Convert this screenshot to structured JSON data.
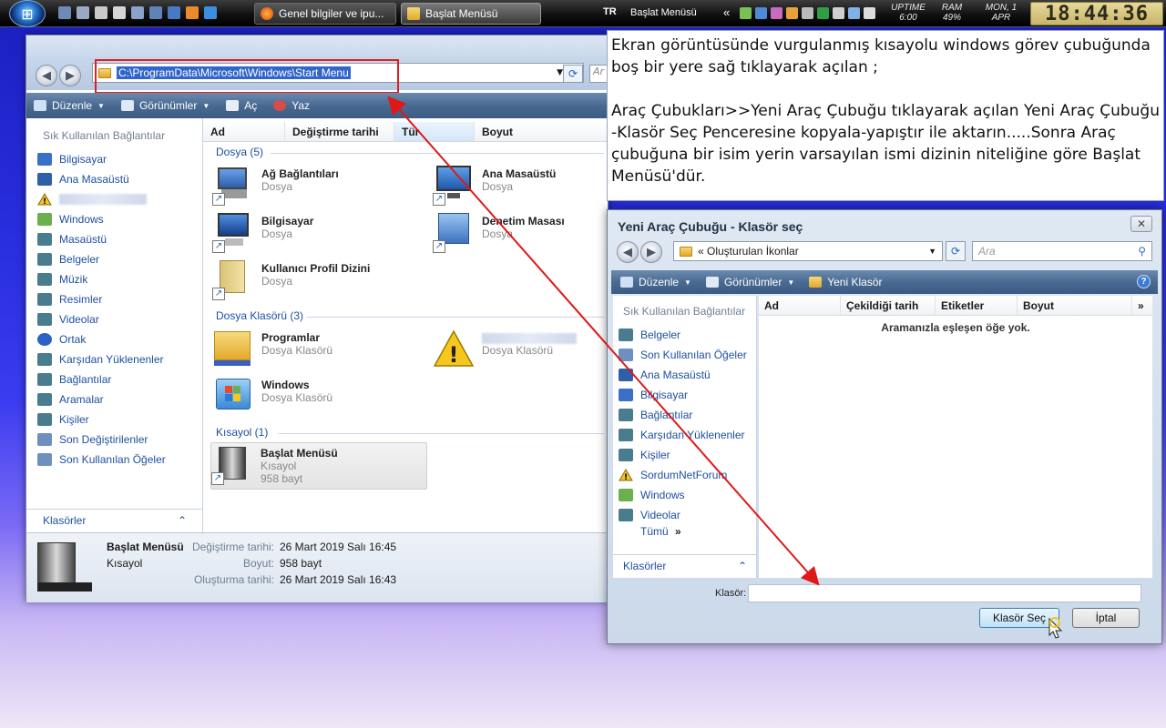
{
  "taskbar": {
    "start_icon": "windows-orb-icon",
    "task1_label": "Genel bilgiler ve ipu...",
    "task2_label": "Başlat Menüsü",
    "lang": "TR",
    "toolbar_name": "Başlat Menüsü",
    "uptime_label": "UPTIME",
    "uptime_value": "6:00",
    "ram_label": "RAM",
    "ram_value": "49%",
    "date_day": "MON, 1",
    "date_month": "APR",
    "clock": "18:44:36"
  },
  "explorer": {
    "address": "C:\\ProgramData\\Microsoft\\Windows\\Start Menu",
    "search_stub": "Ar",
    "toolbar": {
      "organize": "Düzenle",
      "views": "Görünümler",
      "open": "Aç",
      "print": "Yaz"
    },
    "nav_header": "Sık Kullanılan Bağlantılar",
    "nav_items": [
      {
        "label": "Bilgisayar",
        "icon": "computer-icon",
        "color": "#3a6fc8"
      },
      {
        "label": "Ana Masaüstü",
        "icon": "desktop-icon",
        "color": "#2f5fa8"
      },
      {
        "label": "",
        "icon": "warning-icon",
        "color": "#f2c230"
      },
      {
        "label": "Windows",
        "icon": "windows-folder-icon",
        "color": "#6ab04c"
      },
      {
        "label": "Masaüstü",
        "icon": "desktop-folder-icon",
        "color": "#4a7c8f"
      },
      {
        "label": "Belgeler",
        "icon": "documents-icon",
        "color": "#4a7c8f"
      },
      {
        "label": "Müzik",
        "icon": "music-icon",
        "color": "#4a7c8f"
      },
      {
        "label": "Resimler",
        "icon": "pictures-icon",
        "color": "#4a7c8f"
      },
      {
        "label": "Videolar",
        "icon": "videos-icon",
        "color": "#4a7c8f"
      },
      {
        "label": "Ortak",
        "icon": "info-icon",
        "color": "#2a62c6"
      },
      {
        "label": "Karşıdan Yüklenenler",
        "icon": "downloads-icon",
        "color": "#4a7c8f"
      },
      {
        "label": "Bağlantılar",
        "icon": "links-icon",
        "color": "#4a7c8f"
      },
      {
        "label": "Aramalar",
        "icon": "searches-icon",
        "color": "#4a7c8f"
      },
      {
        "label": "Kişiler",
        "icon": "contacts-icon",
        "color": "#4a7c8f"
      },
      {
        "label": "Son Değiştirilenler",
        "icon": "recent-changes-icon",
        "color": "#6e8fbf"
      },
      {
        "label": "Son Kullanılan Öğeler",
        "icon": "recent-items-icon",
        "color": "#6e8fbf"
      }
    ],
    "folders_label": "Klasörler",
    "columns": [
      "Ad",
      "Değiştirme tarihi",
      "Tür",
      "Boyut"
    ],
    "groups": {
      "files": "Dosya (5)",
      "folders": "Dosya Klasörü (3)",
      "shortcuts": "Kısayol (1)"
    },
    "items": {
      "network": {
        "name": "Ağ Bağlantıları",
        "type": "Dosya"
      },
      "desktop": {
        "name": "Ana Masaüstü",
        "type": "Dosya"
      },
      "computer": {
        "name": "Bilgisayar",
        "type": "Dosya"
      },
      "control": {
        "name": "Denetim Masası",
        "type": "Dosya"
      },
      "profile": {
        "name": "Kullanıcı Profil Dizini",
        "type": "Dosya"
      },
      "programs": {
        "name": "Programlar",
        "type": "Dosya Klasörü"
      },
      "blurred_folder": {
        "name": "",
        "type": "Dosya Klasörü"
      },
      "windows": {
        "name": "Windows",
        "type": "Dosya Klasörü"
      },
      "start_menu": {
        "name": "Başlat Menüsü",
        "type": "Kısayol",
        "size": "958 bayt"
      }
    },
    "details": {
      "name": "Başlat Menüsü",
      "type": "Kısayol",
      "modified_label": "Değiştirme tarihi:",
      "modified_value": "26 Mart 2019 Salı 16:45",
      "size_label": "Boyut:",
      "size_value": "958 bayt",
      "created_label": "Oluşturma tarihi:",
      "created_value": "26 Mart 2019 Salı 16:43"
    }
  },
  "note": {
    "para1": "Ekran görüntüsünde vurgulanmış kısayolu windows görev çubuğunda boş bir yere sağ tıklayarak açılan ;",
    "para2": "Araç Çubukları>>Yeni Araç Çubuğu tıklayarak açılan Yeni Araç Çubuğu -Klasör Seç Penceresine kopyala-yapıştır ile aktarın.....Sonra Araç çubuğuna  bir isim yerin varsayılan ismi dizinin niteliğine göre Başlat Menüsü'dür."
  },
  "dialog": {
    "title": "Yeni Araç Çubuğu - Klasör seç",
    "close": "✕",
    "address": "«  Oluşturulan İkonlar",
    "search_placeholder": "Ara",
    "toolbar": {
      "organize": "Düzenle",
      "views": "Görünümler",
      "new_folder": "Yeni Klasör"
    },
    "help": "?",
    "nav_header": "Sık Kullanılan Bağlantılar",
    "nav_items": [
      {
        "label": "Belgeler",
        "icon": "documents-icon",
        "color": "#4a7c8f"
      },
      {
        "label": "Son Kullanılan Öğeler",
        "icon": "recent-items-icon",
        "color": "#6e8fbf"
      },
      {
        "label": "Ana Masaüstü",
        "icon": "desktop-icon",
        "color": "#2f5fa8"
      },
      {
        "label": "Bilgisayar",
        "icon": "computer-icon",
        "color": "#3a6fc8"
      },
      {
        "label": "Bağlantılar",
        "icon": "links-icon",
        "color": "#4a7c8f"
      },
      {
        "label": "Karşıdan Yüklenenler",
        "icon": "downloads-icon",
        "color": "#4a7c8f"
      },
      {
        "label": "Kişiler",
        "icon": "contacts-icon",
        "color": "#4a7c8f"
      },
      {
        "label": "SordumNetForum",
        "icon": "warning-icon",
        "color": "#f2c230"
      },
      {
        "label": "Windows",
        "icon": "windows-folder-icon",
        "color": "#6ab04c"
      },
      {
        "label": "Videolar",
        "icon": "videos-icon",
        "color": "#4a7c8f"
      }
    ],
    "more": "Tümü",
    "folders_label": "Klasörler",
    "columns": [
      "Ad",
      "Çekildiği tarih",
      "Etiketler",
      "Boyut"
    ],
    "empty": "Aramanızla eşleşen öğe yok.",
    "folder_label": "Klasör:",
    "folder_value": "",
    "ok": "Klasör Seç",
    "cancel": "İptal"
  }
}
